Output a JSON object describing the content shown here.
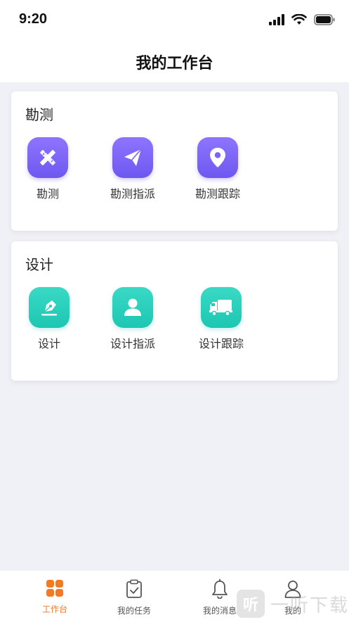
{
  "status": {
    "time": "9:20"
  },
  "header": {
    "title": "我的工作台"
  },
  "sections": [
    {
      "title": "勘测",
      "items": [
        {
          "label": "勘测",
          "icon": "pencil-ruler-icon"
        },
        {
          "label": "勘测指派",
          "icon": "paper-plane-icon"
        },
        {
          "label": "勘测跟踪",
          "icon": "map-pin-icon"
        }
      ],
      "color": "#7a63f6"
    },
    {
      "title": "设计",
      "items": [
        {
          "label": "设计",
          "icon": "pen-nib-icon"
        },
        {
          "label": "设计指派",
          "icon": "person-icon"
        },
        {
          "label": "设计跟踪",
          "icon": "truck-icon"
        }
      ],
      "color": "#22ccb8"
    }
  ],
  "tabbar": {
    "tabs": [
      {
        "label": "工作台",
        "icon": "grid-icon",
        "active": true
      },
      {
        "label": "我的任务",
        "icon": "clipboard-check-icon",
        "active": false
      },
      {
        "label": "我的消息",
        "icon": "bell-icon",
        "active": false
      },
      {
        "label": "我的",
        "icon": "user-icon",
        "active": false
      }
    ],
    "active_color": "#f27a22"
  },
  "watermark": {
    "logo": "听",
    "text": "一听下载"
  }
}
